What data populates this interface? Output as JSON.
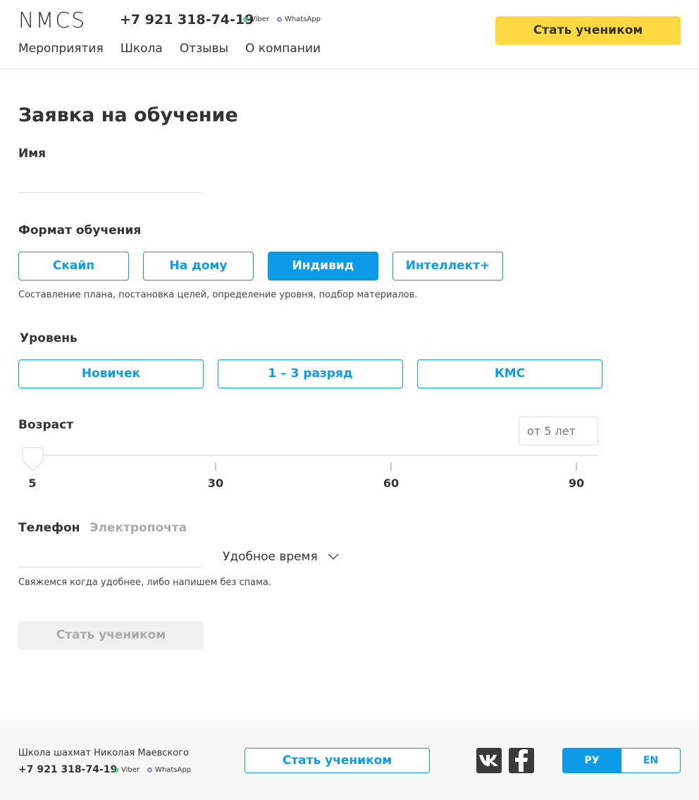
{
  "header": {
    "logo": "NMCS",
    "phone": "+7 921 318-74-19",
    "viber": "Viber",
    "whatsapp": "WhatsApp",
    "nav": [
      "Мероприятия",
      "Школа",
      "Отзывы",
      "О компании"
    ],
    "cta": "Стать учеником"
  },
  "form": {
    "title": "Заявка на обучение",
    "name_label": "Имя",
    "name_value": "",
    "format_label": "Формат обучения",
    "formats": [
      "Скайп",
      "На дому",
      "Индивид",
      "Интеллект+"
    ],
    "format_selected": "Индивид",
    "format_hint": "Составление плана, постановка целей, определение уровня, подбор материалов.",
    "level_label": "Уровень",
    "levels": [
      "Новичек",
      "1 – 3 разряд",
      "КМС"
    ],
    "age_label": "Возраст",
    "age_placeholder": "от 5 лет",
    "age_ticks": [
      "5",
      "30",
      "60",
      "90"
    ],
    "age_value": 5,
    "contact_tabs": [
      "Телефон",
      "Электропочта"
    ],
    "contact_active": "Телефон",
    "contact_value": "",
    "time_select": "Удобное время",
    "contact_hint": "Свяжемся  когда удобнее, либо напишем без спама.",
    "submit": "Стать учеником"
  },
  "footer": {
    "school_name": "Школа шахмат Николая Маевского",
    "phone": "+7 921 318-74-19",
    "viber": "Viber",
    "whatsapp": "WhatsApp",
    "cta": "Стать учеником",
    "social": [
      "vk-icon",
      "facebook-icon"
    ],
    "lang_ru": "РУ",
    "lang_en": "EN",
    "lang_active": "РУ"
  },
  "colors": {
    "accent_blue": "#0d9ae6",
    "accent_yellow": "#ffd93f",
    "viber_dot": "#3dc96b",
    "whatsapp_dot": "#8e7be0"
  }
}
